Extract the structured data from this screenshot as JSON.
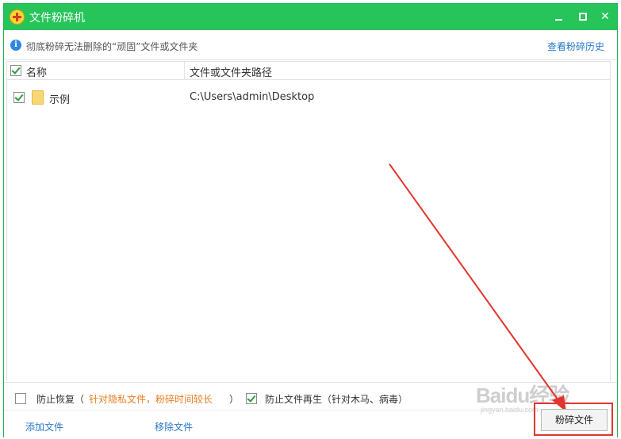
{
  "window": {
    "title": "文件粉碎机"
  },
  "infobar": {
    "text": "彻底粉碎无法删除的“顽固”文件或文件夹",
    "history_link": "查看粉碎历史"
  },
  "table": {
    "columns": {
      "name": "名称",
      "path": "文件或文件夹路径"
    },
    "rows": [
      {
        "checked": true,
        "name": "示例",
        "path": "C:\\Users\\admin\\Desktop"
      }
    ]
  },
  "options": {
    "prevent_recovery": {
      "checked": false,
      "label": "防止恢复（",
      "hint": "针对隐私文件，粉碎时间较长",
      "close_paren": "）"
    },
    "prevent_regeneration": {
      "checked": true,
      "label": "防止文件再生（针对木马、病毒）"
    }
  },
  "footer": {
    "add_file": "添加文件",
    "remove_file": "移除文件",
    "shred_button": "粉碎文件"
  },
  "watermark": {
    "brand": "Baidu经验",
    "url": "jingyan.baidu.com"
  },
  "colors": {
    "titlebar": "#27c45a",
    "link": "#2a78c9",
    "hint": "#e67e22",
    "annotation": "#e2352d"
  },
  "icons": [
    "app-logo-icon",
    "minimize-icon",
    "maximize-icon",
    "close-icon",
    "info-icon",
    "folder-icon"
  ]
}
